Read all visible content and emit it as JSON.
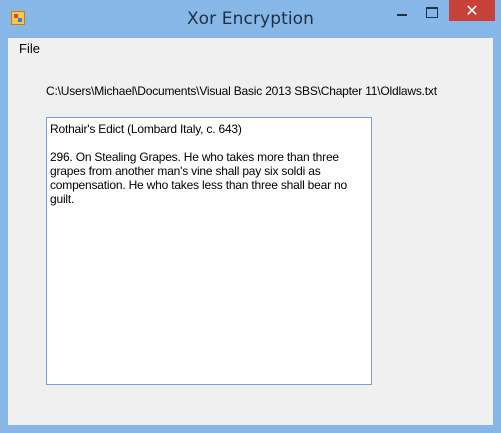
{
  "window": {
    "title": "Xor Encryption",
    "icon": "app-icon",
    "controls": {
      "minimize_icon": "minimize-icon",
      "maximize_icon": "maximize-icon",
      "close_glyph": "✕",
      "close_color": "#c7403a"
    },
    "frame_color": "#86b7e6"
  },
  "menu": {
    "file_label": "File"
  },
  "main": {
    "file_path": "C:\\Users\\Michael\\Documents\\Visual Basic 2013 SBS\\Chapter 11\\Oldlaws.txt",
    "text_content": "Rothair's Edict (Lombard Italy, c. 643)\n\n296. On Stealing Grapes. He who takes more than three grapes from another man's vine shall pay six soldi as compensation. He who takes less than three shall bear no guilt."
  }
}
